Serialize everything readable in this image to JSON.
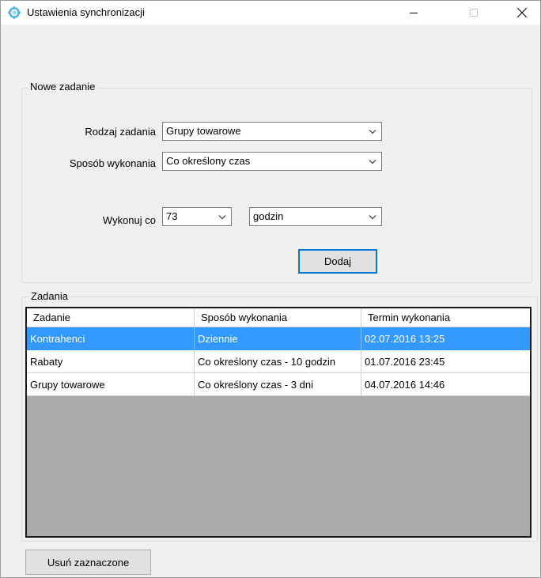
{
  "window": {
    "title": "Ustawienia synchronizacji",
    "accent": "#0078d7"
  },
  "new_task": {
    "group_label": "Nowe zadanie",
    "task_type_label": "Rodzaj zadania",
    "task_type_value": "Grupy towarowe",
    "execution_label": "Sposób wykonania",
    "execution_value": "Co określony czas",
    "every_label": "Wykonuj co",
    "every_value": "73",
    "unit_value": "godzin",
    "add_button": "Dodaj"
  },
  "tasks": {
    "group_label": "Zadania",
    "columns": [
      "Zadanie",
      "Sposób wykonania",
      "Termin wykonania"
    ],
    "rows": [
      [
        "Kontrahenci",
        "Dziennie",
        "02.07.2016 13:25"
      ],
      [
        "Rabaty",
        "Co określony czas - 10 godzin",
        "01.07.2016 23:45"
      ],
      [
        "Grupy towarowe",
        "Co określony czas - 3 dni",
        "04.07.2016 14:46"
      ]
    ],
    "selected_row": 0,
    "selection_color": "#3399ff"
  },
  "footer": {
    "delete_button": "Usuń zaznaczone"
  }
}
